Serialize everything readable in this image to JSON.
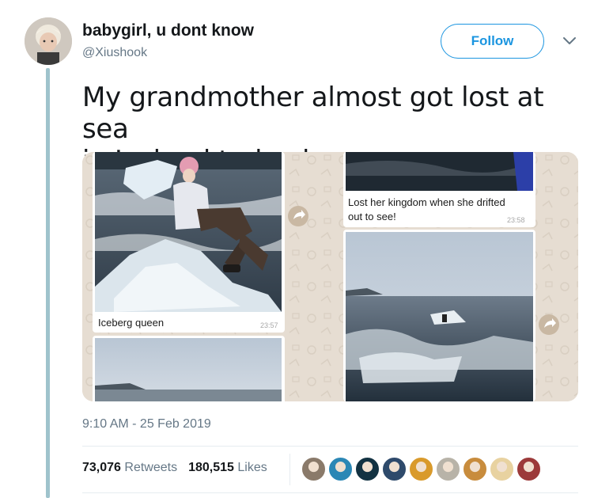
{
  "author": {
    "display_name": "babygirl, u dont know",
    "handle": "@Xiushook"
  },
  "follow_label": "Follow",
  "tweet": {
    "text_line1": "My grandmother almost got lost at sea",
    "text_line2": "in Iceland today lmaoooo"
  },
  "media": {
    "left_caption": "Iceberg queen",
    "left_time": "23:57",
    "right_caption_line1": "Lost her kingdom when she drifted",
    "right_caption_line2": "out to see!",
    "right_time": "23:58"
  },
  "timestamp": "9:10 AM - 25 Feb 2019",
  "stats": {
    "retweets_count": "73,076",
    "retweets_label": "Retweets",
    "likes_count": "180,515",
    "likes_label": "Likes"
  },
  "likers": [
    {
      "name": "liker-avatar-1",
      "color": "#8a7a6a"
    },
    {
      "name": "liker-avatar-2",
      "color": "#2b87b5"
    },
    {
      "name": "liker-avatar-3",
      "color": "#123242"
    },
    {
      "name": "liker-avatar-4",
      "color": "#2e4a6b"
    },
    {
      "name": "liker-avatar-5",
      "color": "#d99a2b"
    },
    {
      "name": "liker-avatar-6",
      "color": "#b8b3a8"
    },
    {
      "name": "liker-avatar-7",
      "color": "#c88c3d"
    },
    {
      "name": "liker-avatar-8",
      "color": "#e8d2a0"
    },
    {
      "name": "liker-avatar-9",
      "color": "#9c3a3a"
    }
  ],
  "colors": {
    "link_blue": "#1b95e0",
    "muted": "#657786",
    "thread_line": "#9fc3cc"
  }
}
